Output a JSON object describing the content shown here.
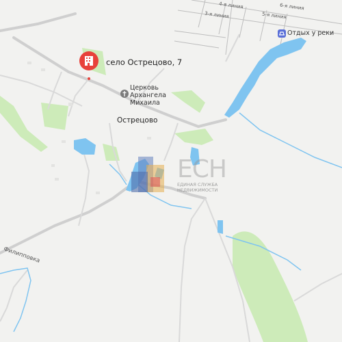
{
  "map": {
    "pin_label": "село Острецово, 7",
    "village_label": "Острецово",
    "church_label_line1": "Церковь",
    "church_label_line2": "Архангела",
    "church_label_line3": "Михаила",
    "poi_label": "Отдых у реки",
    "streets": [
      "4-я линия",
      "6-я линия",
      "3-я линия",
      "5-я линия"
    ],
    "road_label": "Филипповка",
    "watermark_main": "ЕСН",
    "watermark_line1": "ЕДИНАЯ СЛУЖБА",
    "watermark_line2": "НЕДВИЖИМОСТИ",
    "colors": {
      "background": "#f2f2f0",
      "water": "#7fc4f0",
      "green": "#c8eab5",
      "road": "#d6d6d6",
      "pin": "#e8413a"
    },
    "icons": [
      "home-pin-icon",
      "church-icon",
      "recreation-icon"
    ]
  }
}
